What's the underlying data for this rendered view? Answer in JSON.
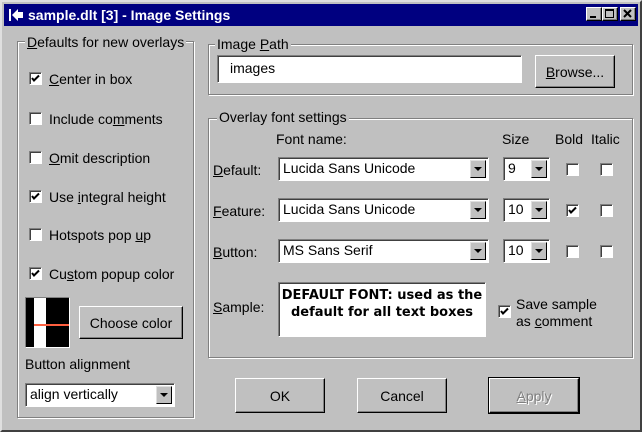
{
  "window": {
    "title": "sample.dlt [3] - Image Settings",
    "controls": {
      "minimize": "_",
      "maximize": "□",
      "close": "✕"
    }
  },
  "defaults_group": {
    "title": "Defaults for new overlays",
    "options": [
      {
        "label": "Center in box",
        "checked": true
      },
      {
        "label": "Include comments",
        "checked": false
      },
      {
        "label": "Omit description",
        "checked": false
      },
      {
        "label": "Use integral height",
        "checked": true
      },
      {
        "label": "Hotspots pop up",
        "checked": false
      },
      {
        "label": "Custom popup color",
        "checked": true
      }
    ],
    "choose_color": "Choose color",
    "button_alignment_label": "Button alignment",
    "button_alignment_value": "align vertically"
  },
  "image_path": {
    "title": "Image Path",
    "value": "images",
    "browse": "Browse..."
  },
  "font_settings": {
    "title": "Overlay font settings",
    "headers": {
      "font_name": "Font name:",
      "size": "Size",
      "bold": "Bold",
      "italic": "Italic"
    },
    "rows": [
      {
        "label": "Default:",
        "font": "Lucida Sans Unicode",
        "size": "9",
        "bold": false,
        "italic": false
      },
      {
        "label": "Feature:",
        "font": "Lucida Sans Unicode",
        "size": "10",
        "bold": true,
        "italic": false
      },
      {
        "label": "Button:",
        "font": "MS Sans Serif",
        "size": "10",
        "bold": false,
        "italic": false
      }
    ],
    "sample_label": "Sample:",
    "sample_text": "DEFAULT FONT: used as the default for all text boxes",
    "save_sample_label": "Save sample as comment",
    "save_sample_checked": true
  },
  "buttons": {
    "ok": "OK",
    "cancel": "Cancel",
    "apply": "Apply"
  },
  "colors": {
    "titlebar": "#000080",
    "face": "#c0c0c0",
    "swatch_line": "#ff6040"
  }
}
